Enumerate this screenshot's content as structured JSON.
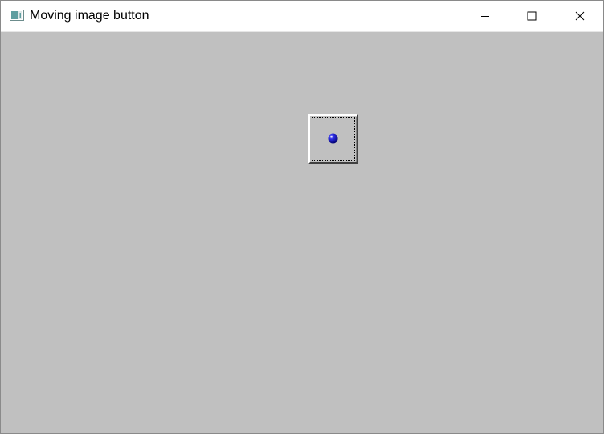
{
  "window": {
    "title": "Moving image button",
    "background_color": "#c0c0c0",
    "controls": {
      "minimize": "minimize-icon",
      "maximize": "maximize-icon",
      "close": "close-icon"
    }
  },
  "image_button": {
    "icon": "blue-ball-icon",
    "ball_color": "#0000c0"
  }
}
